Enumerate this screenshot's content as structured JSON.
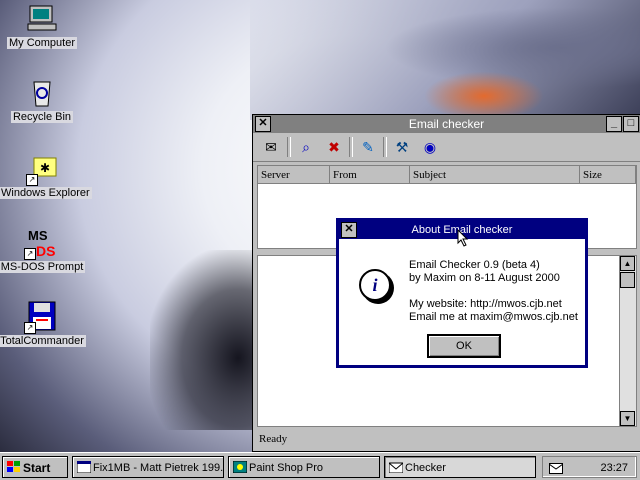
{
  "desktop": {
    "icons": [
      {
        "label": "My Computer",
        "icon": "computer-icon"
      },
      {
        "label": "Recycle Bin",
        "icon": "recycle-bin-icon"
      },
      {
        "label": "Windows Explorer",
        "icon": "explorer-icon"
      },
      {
        "label": "MS-DOS Prompt",
        "icon": "msdos-icon"
      },
      {
        "label": "TotalCommander",
        "icon": "floppy-icon"
      }
    ]
  },
  "main_window": {
    "title": "Email checker",
    "toolbar": [
      {
        "icon": "envelope-icon"
      },
      {
        "icon": "find-icon"
      },
      {
        "icon": "delete-mail-icon"
      },
      {
        "icon": "pencil-icon"
      },
      {
        "icon": "tools-icon"
      },
      {
        "icon": "help-icon"
      }
    ],
    "columns": [
      "Server",
      "From",
      "Subject",
      "Size"
    ],
    "status": "Ready"
  },
  "about_dialog": {
    "title": "About Email checker",
    "line1": "Email Checker 0.9 (beta 4)",
    "line2": "by Maxim on 8-11 August 2000",
    "line3": "My website: http://mwos.cjb.net",
    "line4": "Email me at maxim@mwos.cjb.net",
    "ok_label": "OK"
  },
  "taskbar": {
    "start_label": "Start",
    "items": [
      {
        "label": "Fix1MB - Matt Pietrek 199...",
        "active": false
      },
      {
        "label": "Paint Shop Pro",
        "active": false
      },
      {
        "label": "Checker",
        "active": true
      }
    ],
    "clock": "23:27"
  },
  "colors": {
    "title_active": "#000080",
    "title_inactive": "#808080",
    "face": "#c0c0c0"
  }
}
